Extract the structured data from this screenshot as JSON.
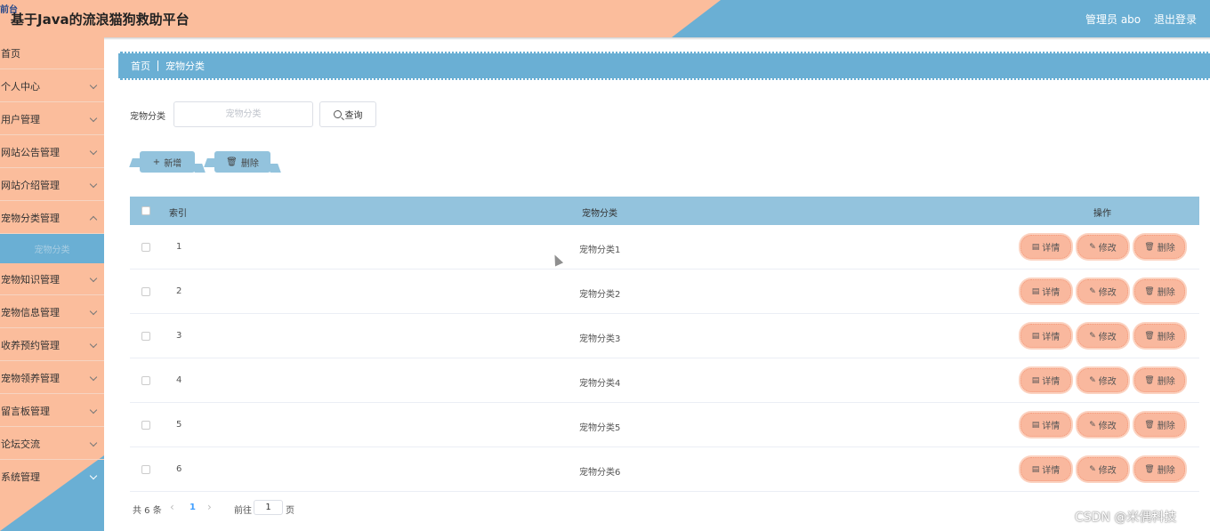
{
  "header": {
    "logo_glyph": "前台",
    "title": "基于Java的流浪猫狗救助平台",
    "user": "管理员 abo",
    "logout": "退出登录"
  },
  "sidebar": {
    "items": [
      {
        "label": "首页",
        "has_chevron": false
      },
      {
        "label": "个人中心",
        "has_chevron": true
      },
      {
        "label": "用户管理",
        "has_chevron": true
      },
      {
        "label": "网站公告管理",
        "has_chevron": true
      },
      {
        "label": "网站介绍管理",
        "has_chevron": true
      },
      {
        "label": "宠物分类管理",
        "has_chevron": true
      },
      {
        "label": "宠物知识管理",
        "has_chevron": true
      },
      {
        "label": "宠物信息管理",
        "has_chevron": true
      },
      {
        "label": "收养预约管理",
        "has_chevron": true
      },
      {
        "label": "宠物领养管理",
        "has_chevron": true
      },
      {
        "label": "留言板管理",
        "has_chevron": true
      },
      {
        "label": "论坛交流",
        "has_chevron": true
      },
      {
        "label": "系统管理",
        "has_chevron": true
      }
    ],
    "active_sub": "宠物分类"
  },
  "breadcrumb": {
    "home": "首页",
    "current": "宠物分类"
  },
  "search": {
    "label": "宠物分类",
    "placeholder": "宠物分类",
    "query_label": "查询"
  },
  "toolbar": {
    "add_label": "新增",
    "delete_label": "删除"
  },
  "table": {
    "headers": {
      "index": "索引",
      "category": "宠物分类",
      "ops": "操作"
    },
    "rows": [
      {
        "index": "1",
        "category": "宠物分类1"
      },
      {
        "index": "2",
        "category": "宠物分类2"
      },
      {
        "index": "3",
        "category": "宠物分类3"
      },
      {
        "index": "4",
        "category": "宠物分类4"
      },
      {
        "index": "5",
        "category": "宠物分类5"
      },
      {
        "index": "6",
        "category": "宠物分类6"
      }
    ],
    "op_labels": {
      "detail": "详情",
      "edit": "修改",
      "delete": "删除"
    }
  },
  "pagination": {
    "total": "共 6 条",
    "current_page": "1",
    "goto_label": "前往",
    "goto_value": "1",
    "page_suffix": "页"
  },
  "watermark": "CSDN @米偶科技",
  "colors": {
    "peach": "#fbbd9c",
    "blue": "#6aafd4",
    "table_head": "#93c3dd",
    "op_button": "#f9b89e"
  }
}
